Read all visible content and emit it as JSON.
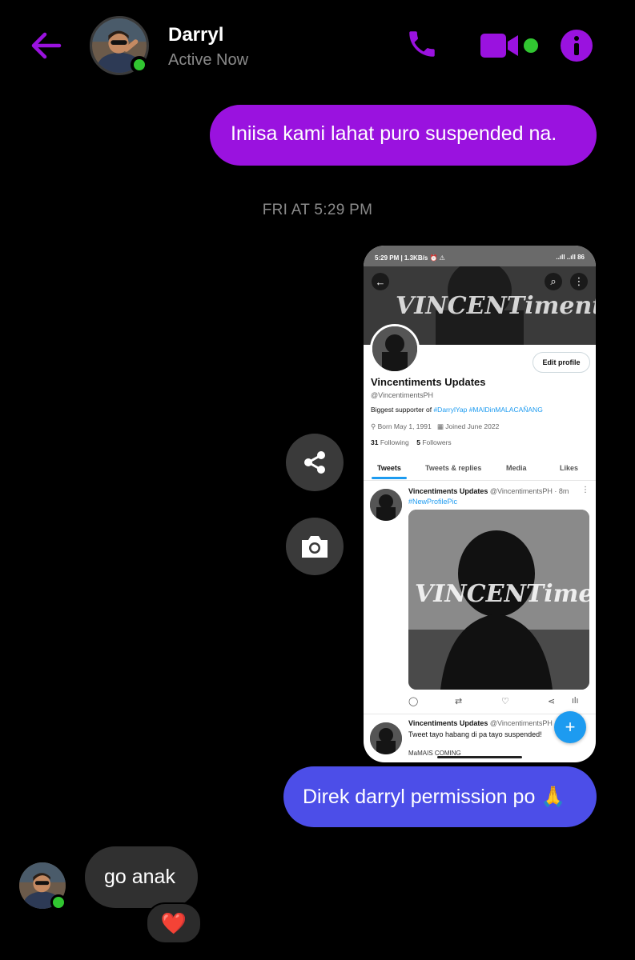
{
  "header": {
    "contact_name": "Darryl",
    "status": "Active Now",
    "icons": [
      "back-arrow-icon",
      "phone-icon",
      "video-camera-icon",
      "info-icon"
    ],
    "accent_color": "#9a12df",
    "online_color": "#31c631"
  },
  "messages": {
    "sent_1": "Iniisa kami lahat puro suspended na.",
    "timestamp": "FRI AT 5:29 PM",
    "sent_2": "Direk darryl permission po 🙏",
    "received_1": "go anak",
    "reaction": "❤️"
  },
  "colors": {
    "sent_1": "#9a12df",
    "sent_2": "#4c4ee8",
    "received": "#303030"
  },
  "attachment": {
    "status_bar": {
      "left": "5:29 PM | 1.3KB/s ⏰ ⚠",
      "right": "..ıll ..ıll 86"
    },
    "banner_text": "VINCENTiments",
    "edit_profile": "Edit profile",
    "display_name": "Vincentiments Updates",
    "handle": "@VincentimentsPH",
    "bio_prefix": "Biggest supporter of",
    "bio_tags": "#DarrylYap #MAIDinMALACAÑANG",
    "born": "Born May 1, 1991",
    "joined": "Joined June 2022",
    "following_count": "31",
    "following_label": "Following",
    "followers_count": "5",
    "followers_label": "Followers",
    "tabs": [
      "Tweets",
      "Tweets & replies",
      "Media",
      "Likes"
    ],
    "tweet1": {
      "name": "Vincentiments Updates",
      "meta": "@VincentimentsPH · 8m",
      "text": "#NewProfilePic",
      "image_text": "VINCENTiments"
    },
    "tweet2": {
      "name": "Vincentiments Updates",
      "meta": "@VincentimentsPH",
      "text": "Tweet tayo habang di pa tayo suspended!",
      "text2": "MaMAIS COMING"
    }
  }
}
